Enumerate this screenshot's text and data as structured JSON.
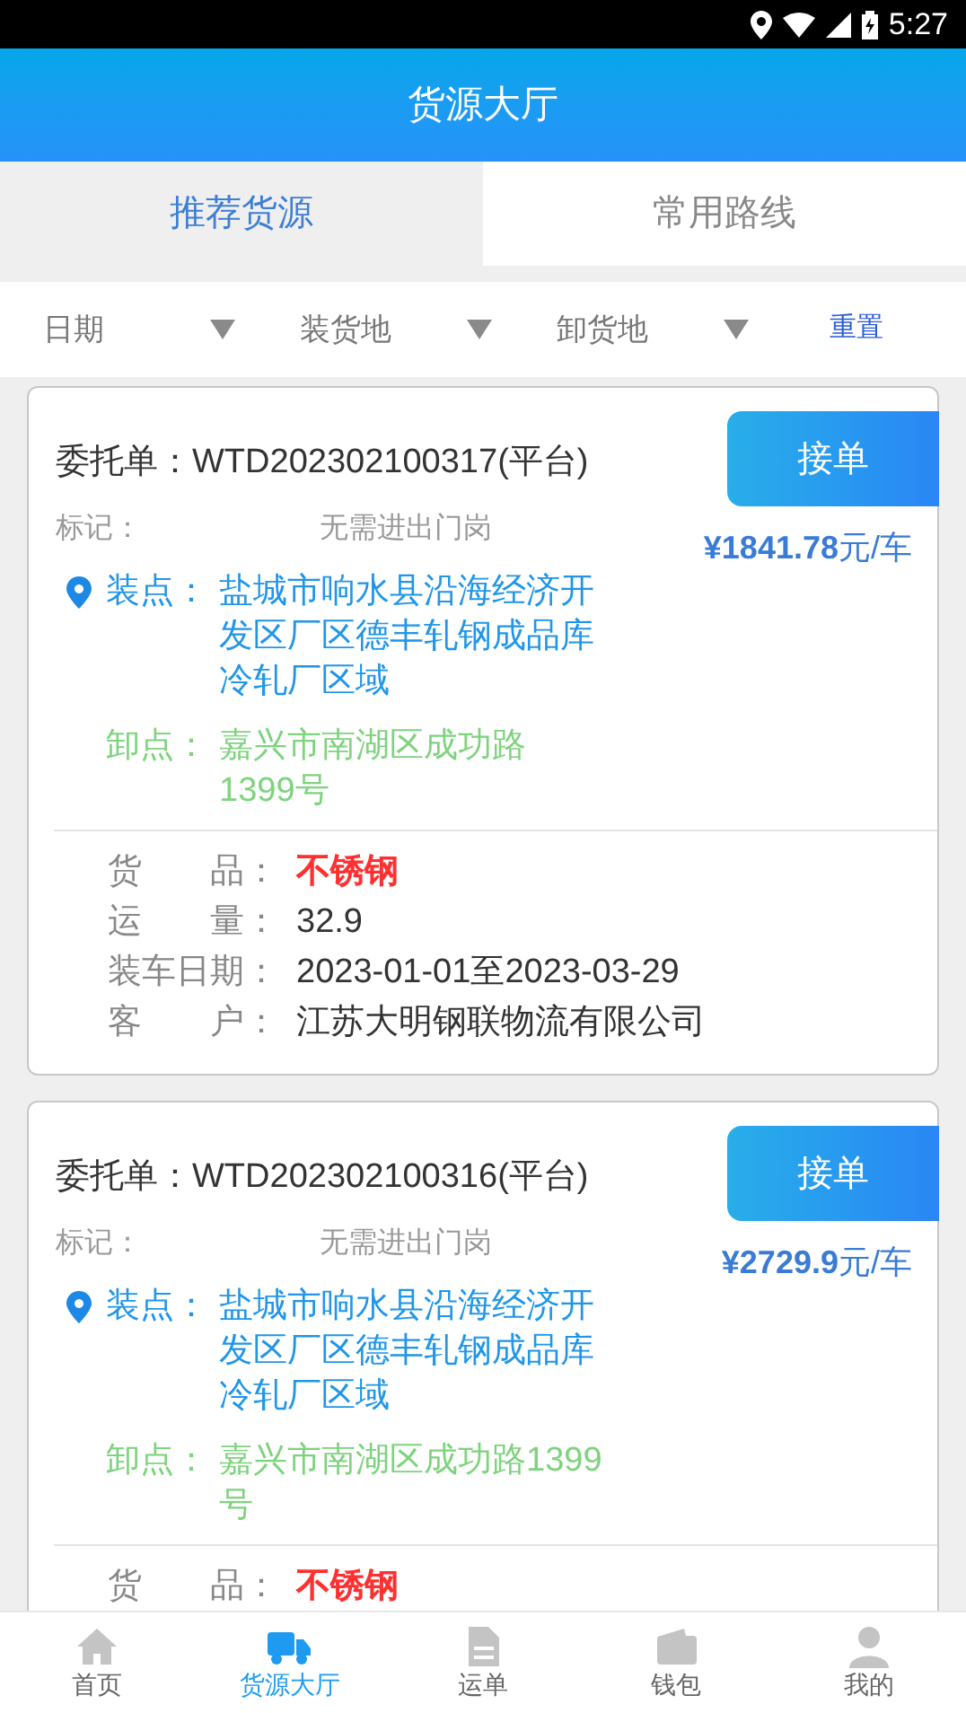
{
  "status_bar": {
    "time": "5:27"
  },
  "header": {
    "title": "货源大厅"
  },
  "tabs": [
    {
      "label": "推荐货源",
      "selected": true
    },
    {
      "label": "常用路线",
      "selected": false
    }
  ],
  "filters": [
    {
      "label": "日期"
    },
    {
      "label": "装货地"
    },
    {
      "label": "卸货地"
    }
  ],
  "reset": "重置",
  "orders": [
    {
      "title": "委托单：WTD202302100317(平台)",
      "button": "接单",
      "remark_label": "标记：",
      "remark": "无需进出门岗",
      "price": "¥1841.78",
      "unit": "元/车",
      "load_label": "装点：",
      "load": "盐城市响水县沿海经济开发区厂区德丰轧钢成品库冷轧厂区域",
      "unload_label": "卸点：",
      "unload": "嘉兴市南湖区成功路1399号",
      "details": [
        {
          "label": "货　　品：",
          "value": "不锈钢",
          "highlight": true
        },
        {
          "label": "运　　量：",
          "value": "32.9",
          "highlight": false
        },
        {
          "label": "装车日期：",
          "value": "2023-01-01至2023-03-29",
          "highlight": false
        },
        {
          "label": "客　　户：",
          "value": "江苏大明钢联物流有限公司",
          "highlight": false
        }
      ]
    },
    {
      "title": "委托单：WTD202302100316(平台)",
      "button": "接单",
      "remark_label": "标记：",
      "remark": "无需进出门岗",
      "price": "¥2729.9",
      "unit": "元/车",
      "load_label": "装点：",
      "load": "盐城市响水县沿海经济开发区厂区德丰轧钢成品库冷轧厂区域",
      "unload_label": "卸点：",
      "unload": "嘉兴市南湖区成功路1399号",
      "details": [
        {
          "label": "货　　品：",
          "value": "不锈钢",
          "highlight": true
        }
      ]
    }
  ],
  "nav": [
    {
      "kind": "home",
      "label": "首页",
      "selected": false
    },
    {
      "kind": "truck",
      "label": "货源大厅",
      "selected": true
    },
    {
      "kind": "document",
      "label": "运单",
      "selected": false
    },
    {
      "kind": "wallet",
      "label": "钱包",
      "selected": false
    },
    {
      "kind": "person",
      "label": "我的",
      "selected": false
    }
  ]
}
